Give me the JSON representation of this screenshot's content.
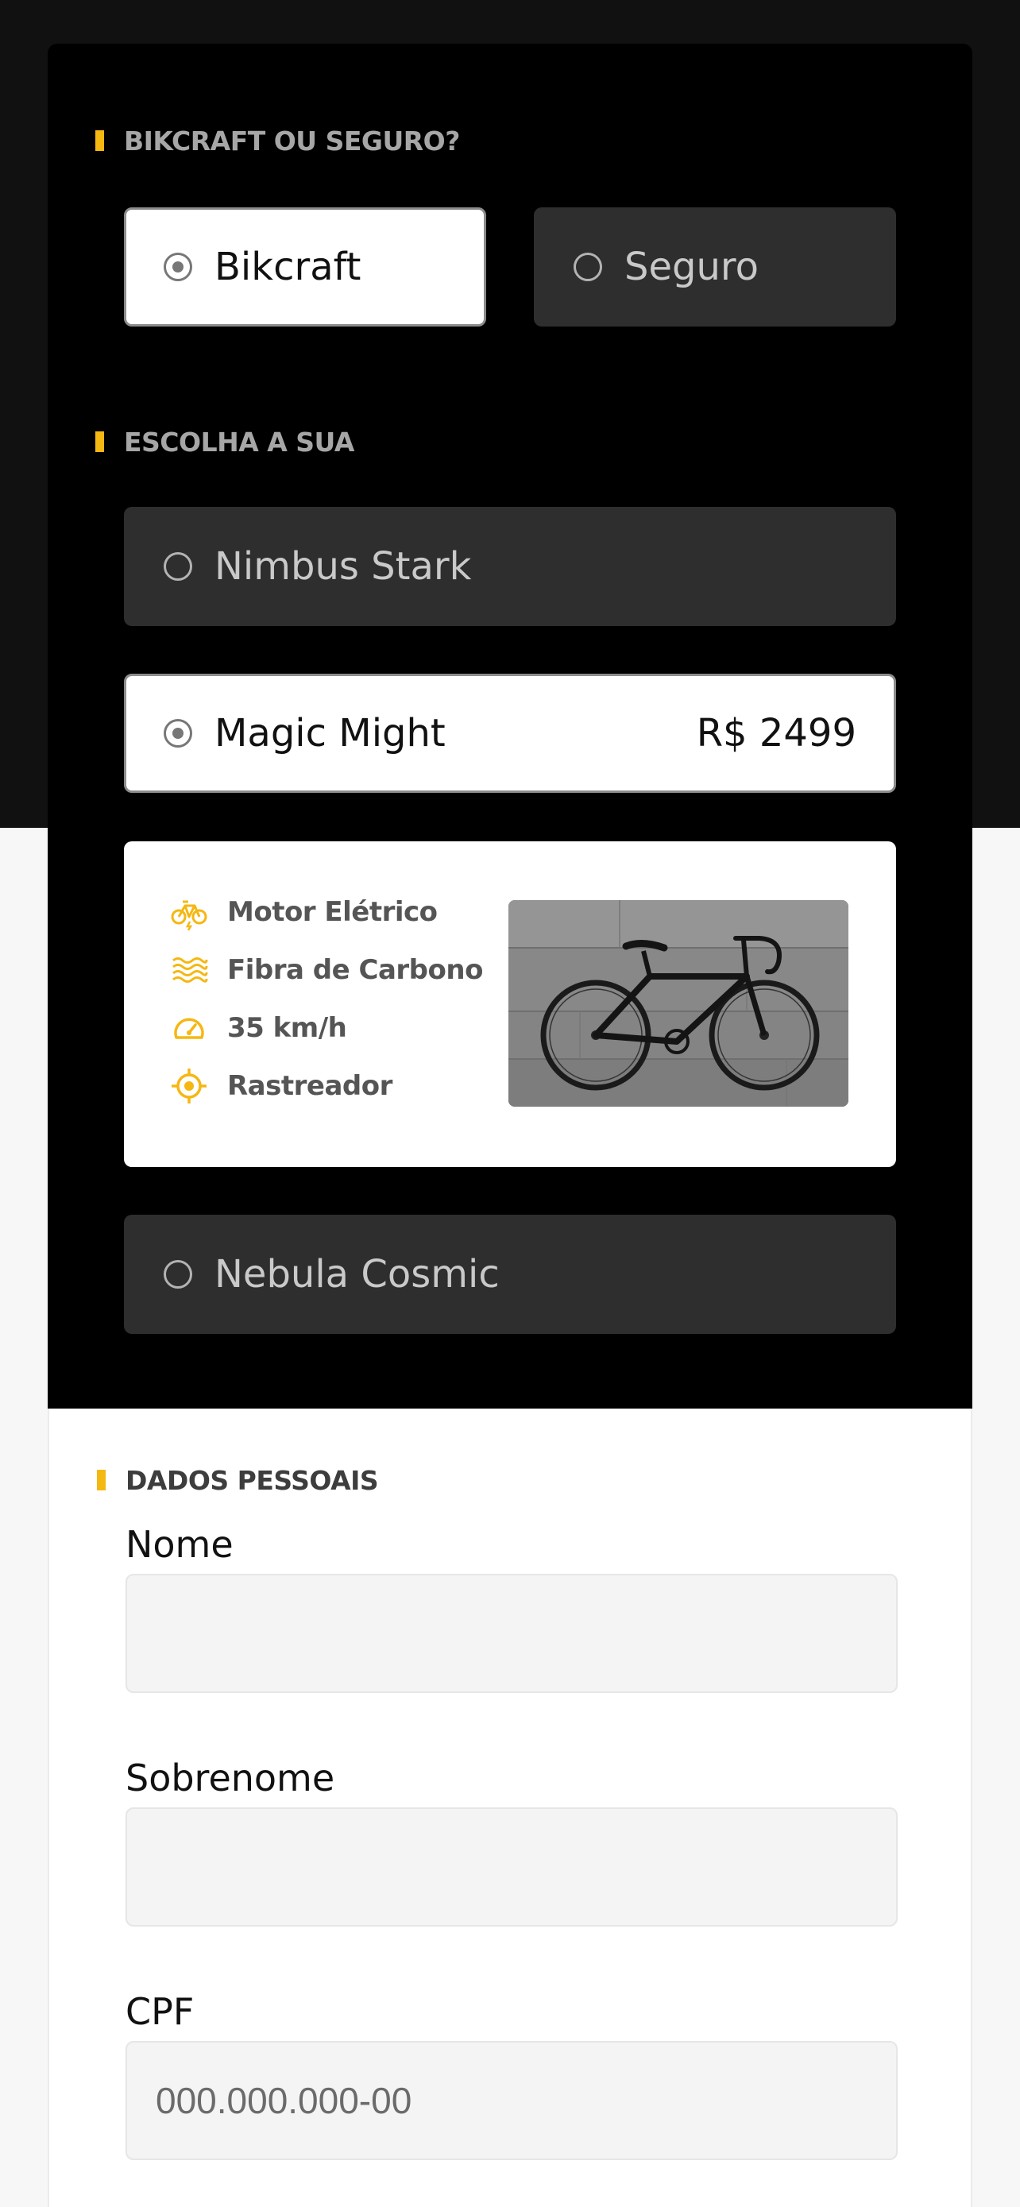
{
  "colors": {
    "accent": "#f5b712",
    "dark_bg": "#000000",
    "option_bg": "#2e2e2e"
  },
  "section_brand": {
    "title": "BIKCRAFT OU SEGURO?",
    "options": [
      {
        "label": "Bikcraft",
        "selected": true
      },
      {
        "label": "Seguro",
        "selected": false
      }
    ]
  },
  "section_model": {
    "title": "ESCOLHA A SUA",
    "options": [
      {
        "label": "Nimbus Stark",
        "selected": false,
        "price": ""
      },
      {
        "label": "Magic Might",
        "selected": true,
        "price": "R$ 2499"
      },
      {
        "label": "Nebula Cosmic",
        "selected": false,
        "price": ""
      }
    ],
    "details": {
      "features": [
        {
          "icon": "electric-bike-icon",
          "label": "Motor Elétrico"
        },
        {
          "icon": "carbon-fiber-icon",
          "label": "Fibra de Carbono"
        },
        {
          "icon": "speedometer-icon",
          "label": "35 km/h"
        },
        {
          "icon": "gps-tracker-icon",
          "label": "Rastreador"
        }
      ],
      "image": "bicycle-photo"
    }
  },
  "section_personal": {
    "title": "DADOS PESSOAIS",
    "fields": [
      {
        "label": "Nome",
        "value": "",
        "placeholder": ""
      },
      {
        "label": "Sobrenome",
        "value": "",
        "placeholder": ""
      },
      {
        "label": "CPF",
        "value": "",
        "placeholder": "000.000.000-00"
      }
    ]
  }
}
